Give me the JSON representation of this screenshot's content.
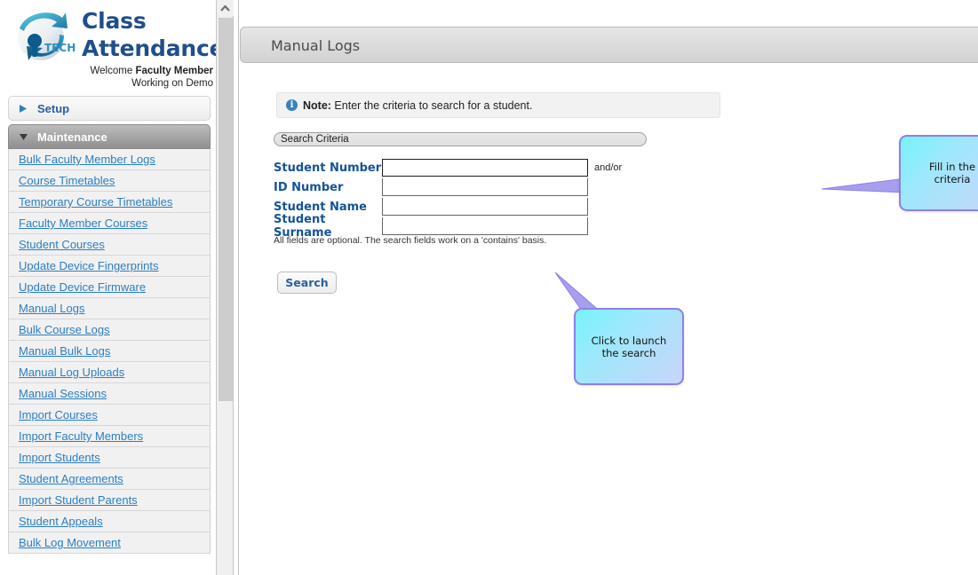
{
  "brand": {
    "logo_icon": "globe-arrows-logo",
    "logo_wordmark": "iP TECH",
    "title_line1": "Class",
    "title_line2": "Attendance",
    "welcome_prefix": "Welcome ",
    "welcome_user": "Faculty Member",
    "working_on": "Working on Demo"
  },
  "sidebar": {
    "sections": [
      {
        "label": "Setup",
        "expanded": false,
        "icon": "chevron-right-icon"
      },
      {
        "label": "Maintenance",
        "expanded": true,
        "icon": "chevron-down-icon"
      }
    ],
    "items": [
      {
        "label": "Bulk Faculty Member Logs"
      },
      {
        "label": "Course Timetables"
      },
      {
        "label": "Temporary Course Timetables"
      },
      {
        "label": "Faculty Member Courses"
      },
      {
        "label": "Student Courses"
      },
      {
        "label": "Update Device Fingerprints"
      },
      {
        "label": "Update Device Firmware"
      },
      {
        "label": "Manual Logs"
      },
      {
        "label": "Bulk Course Logs"
      },
      {
        "label": "Manual Bulk Logs"
      },
      {
        "label": "Manual Log Uploads"
      },
      {
        "label": "Manual Sessions"
      },
      {
        "label": "Import Courses"
      },
      {
        "label": "Import Faculty Members"
      },
      {
        "label": "Import Students"
      },
      {
        "label": "Student Agreements"
      },
      {
        "label": "Import Student Parents"
      },
      {
        "label": "Student Appeals"
      },
      {
        "label": "Bulk Log Movement"
      }
    ]
  },
  "scrollbar": {
    "up_arrow_icon": "chevron-up-icon",
    "thumb_position": "top"
  },
  "main": {
    "page_title": "Manual Logs",
    "note": {
      "icon": "info-icon",
      "label": "Note:",
      "text": " Enter the criteria to search for a student."
    },
    "criteria": {
      "legend": "Search Criteria",
      "fields": [
        {
          "label": "Student Number",
          "value": "",
          "placeholder": ""
        },
        {
          "label": "ID Number",
          "value": "",
          "placeholder": ""
        },
        {
          "label": "Student Name",
          "value": "",
          "placeholder": ""
        },
        {
          "label": "Student Surname",
          "value": "",
          "placeholder": ""
        }
      ],
      "and_or": "and/or",
      "hint": "All fields are optional. The search fields work on a 'contains' basis."
    },
    "search_button": "Search"
  },
  "callouts": [
    {
      "text": "Fill in the criteria"
    },
    {
      "text": "Click to launch the search"
    }
  ],
  "colors": {
    "brand_blue": "#1f4e8c",
    "link_blue": "#2a7fc4",
    "label_blue": "#14539a",
    "callout_border": "#8f7fe8",
    "callout_fill": "#76f3fb",
    "info_blue": "#3883bd"
  }
}
